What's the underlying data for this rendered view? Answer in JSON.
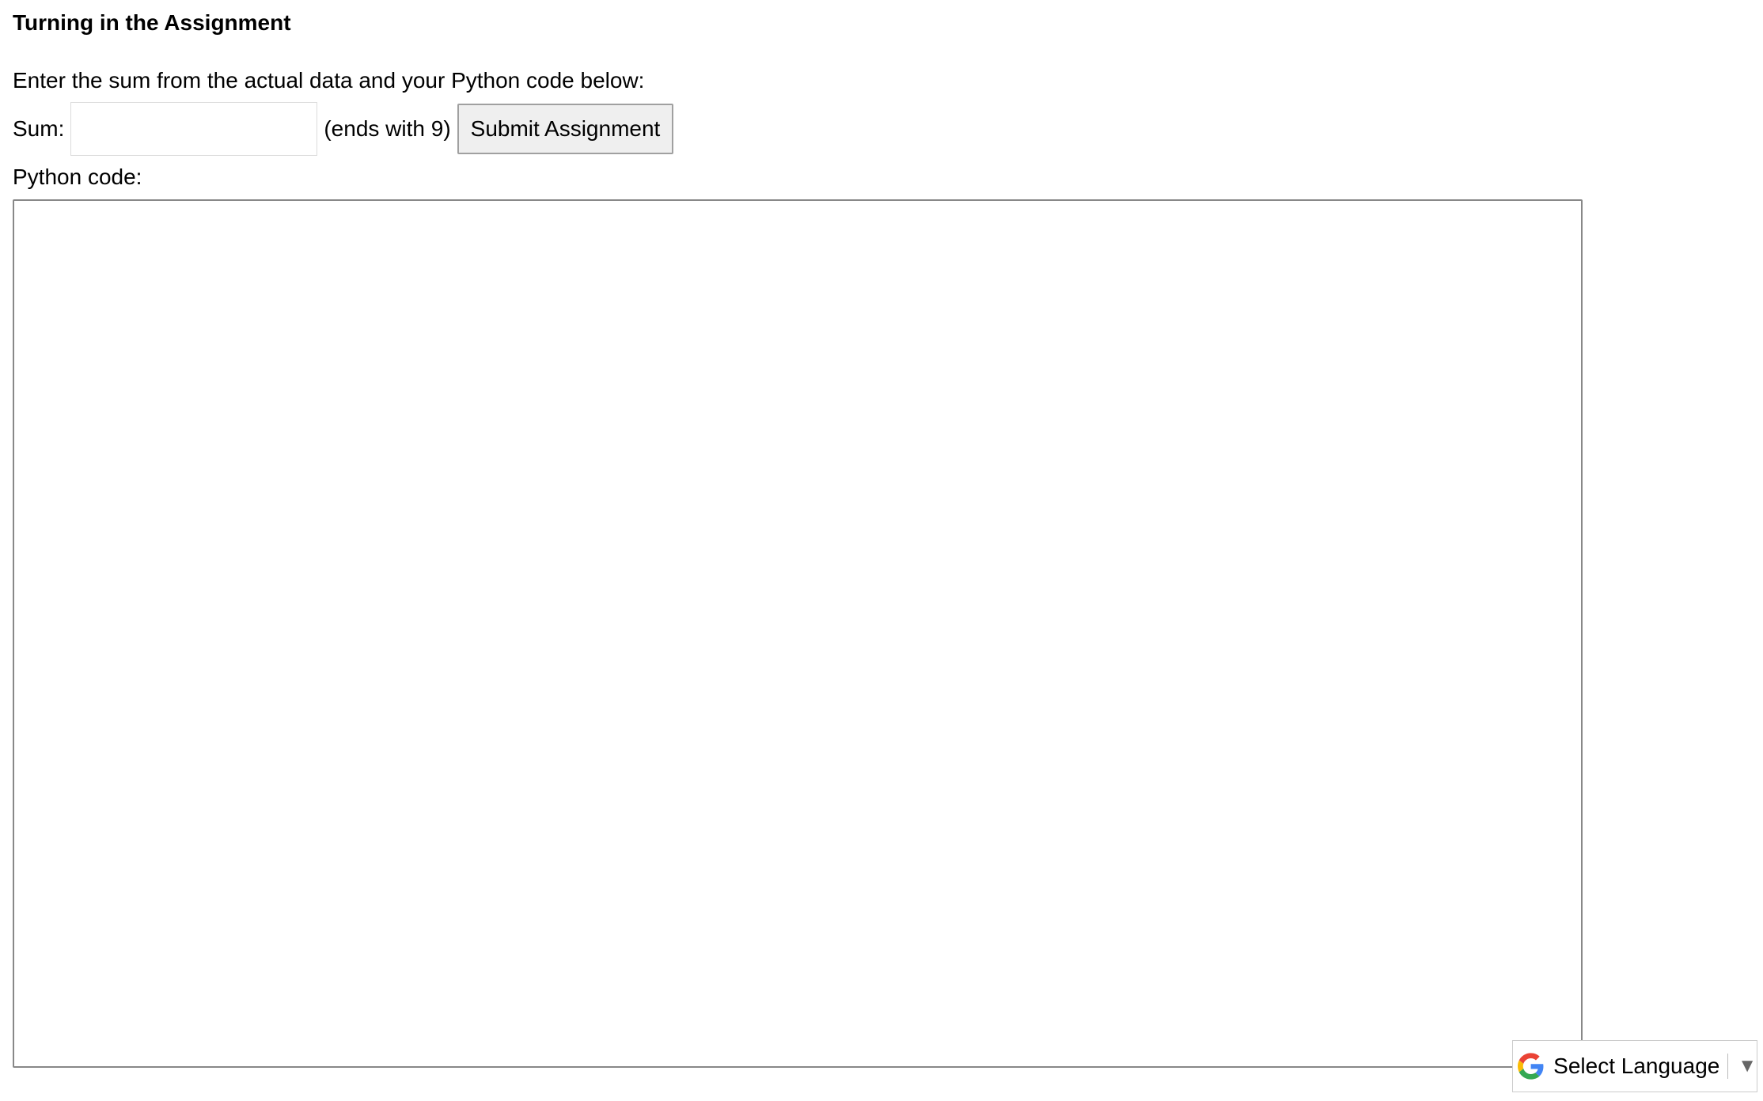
{
  "heading": "Turning in the Assignment",
  "instructions": "Enter the sum from the actual data and your Python code below:",
  "sum_form": {
    "label": "Sum:",
    "value": "",
    "placeholder": "",
    "hint": "(ends with 9)",
    "submit_label": "Submit Assignment"
  },
  "code_form": {
    "label": "Python code:",
    "value": ""
  },
  "language_selector": {
    "label": "Select Language",
    "icon": "google-g-icon",
    "arrow": "▼"
  }
}
